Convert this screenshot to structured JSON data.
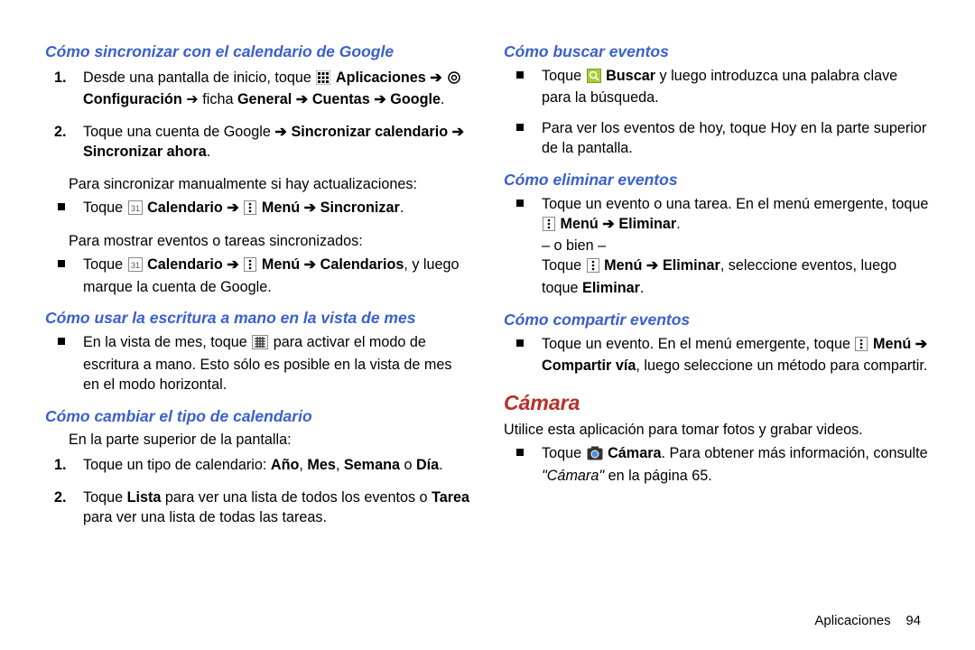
{
  "left": {
    "h1": "Cómo sincronizar con el calendario de Google",
    "ol1_1a": "Desde una pantalla de inicio, toque ",
    "apps": "Aplicaciones",
    "arrow": " ➔ ",
    "config": "Configuración",
    "gen": " ➔ ficha ",
    "general": "General",
    "acc_arrow": " ➔ ",
    "accounts": "Cuentas",
    "google_arrow": " ➔ ",
    "google": "Google",
    "dot": ".",
    "ol1_2a": "Toque una cuenta de Google ",
    "sync_arrow": " ➔ ",
    "sync_cal": "Sincronizar calendario",
    "now_arrow": " ➔ ",
    "sync_now": "Sincronizar ahora",
    "plain1": "Para sincronizar manualmente si hay actualizaciones:",
    "ul1_1a": "Toque ",
    "calendar": "Calendario",
    "menu": "Menú",
    "sync": "Sincronizar",
    "plain2": "Para mostrar eventos o tareas sincronizados:",
    "ul2_1a": "Toque ",
    "calendars": "Calendarios",
    "ul2_1b": ", y luego marque la cuenta de Google.",
    "h2": "Cómo usar la escritura a mano en la vista de mes",
    "ul3_1a": "En la vista de mes, toque ",
    "ul3_1b": " para activar el modo de escritura a mano. Esto sólo es posible en la vista de mes en el modo horizontal.",
    "h3": "Cómo cambiar el tipo de calendario",
    "plain3": "En la parte superior de la pantalla:",
    "ol2_1a": "Toque un tipo de calendario: ",
    "year": "Año",
    "month": "Mes",
    "week": "Semana",
    "or": " o ",
    "day": "Día",
    "ol2_2a": "Toque ",
    "list": "Lista",
    "ol2_2b": " para ver una lista de todos los eventos o ",
    "task": "Tarea",
    "ol2_2c": " para ver una lista de todas las tareas."
  },
  "right": {
    "h1": "Cómo buscar eventos",
    "ul1_1a": "Toque ",
    "search": "Buscar",
    "ul1_1b": " y luego introduzca una palabra clave para la búsqueda.",
    "ul1_2": "Para ver los eventos de hoy, toque Hoy en la parte superior de la pantalla.",
    "h2": "Cómo eliminar eventos",
    "ul2_1a": "Toque un evento o una tarea. En el menú emergente, toque ",
    "menu": "Menú",
    "arrow": " ➔ ",
    "delete": "Eliminar",
    "dot": ".",
    "or": "– o bien –",
    "ul2_1b": "Toque ",
    "ul2_1c": ", seleccione eventos, luego toque ",
    "h3": "Cómo compartir eventos",
    "ul3_1a": "Toque un evento. En el menú emergente, toque ",
    "share": "Compartir vía",
    "ul3_1b": ", luego seleccione un método para compartir.",
    "hred": "Cámara",
    "plain": "Utilice esta aplicación para tomar fotos y grabar videos.",
    "ul4_1a": "Toque ",
    "camera": "Cámara",
    "ul4_1b": ". Para obtener más información, consulte ",
    "ref": "\"Cámara\"",
    "ul4_1c": " en la página 65."
  },
  "footer_label": "Aplicaciones",
  "footer_page": "94"
}
